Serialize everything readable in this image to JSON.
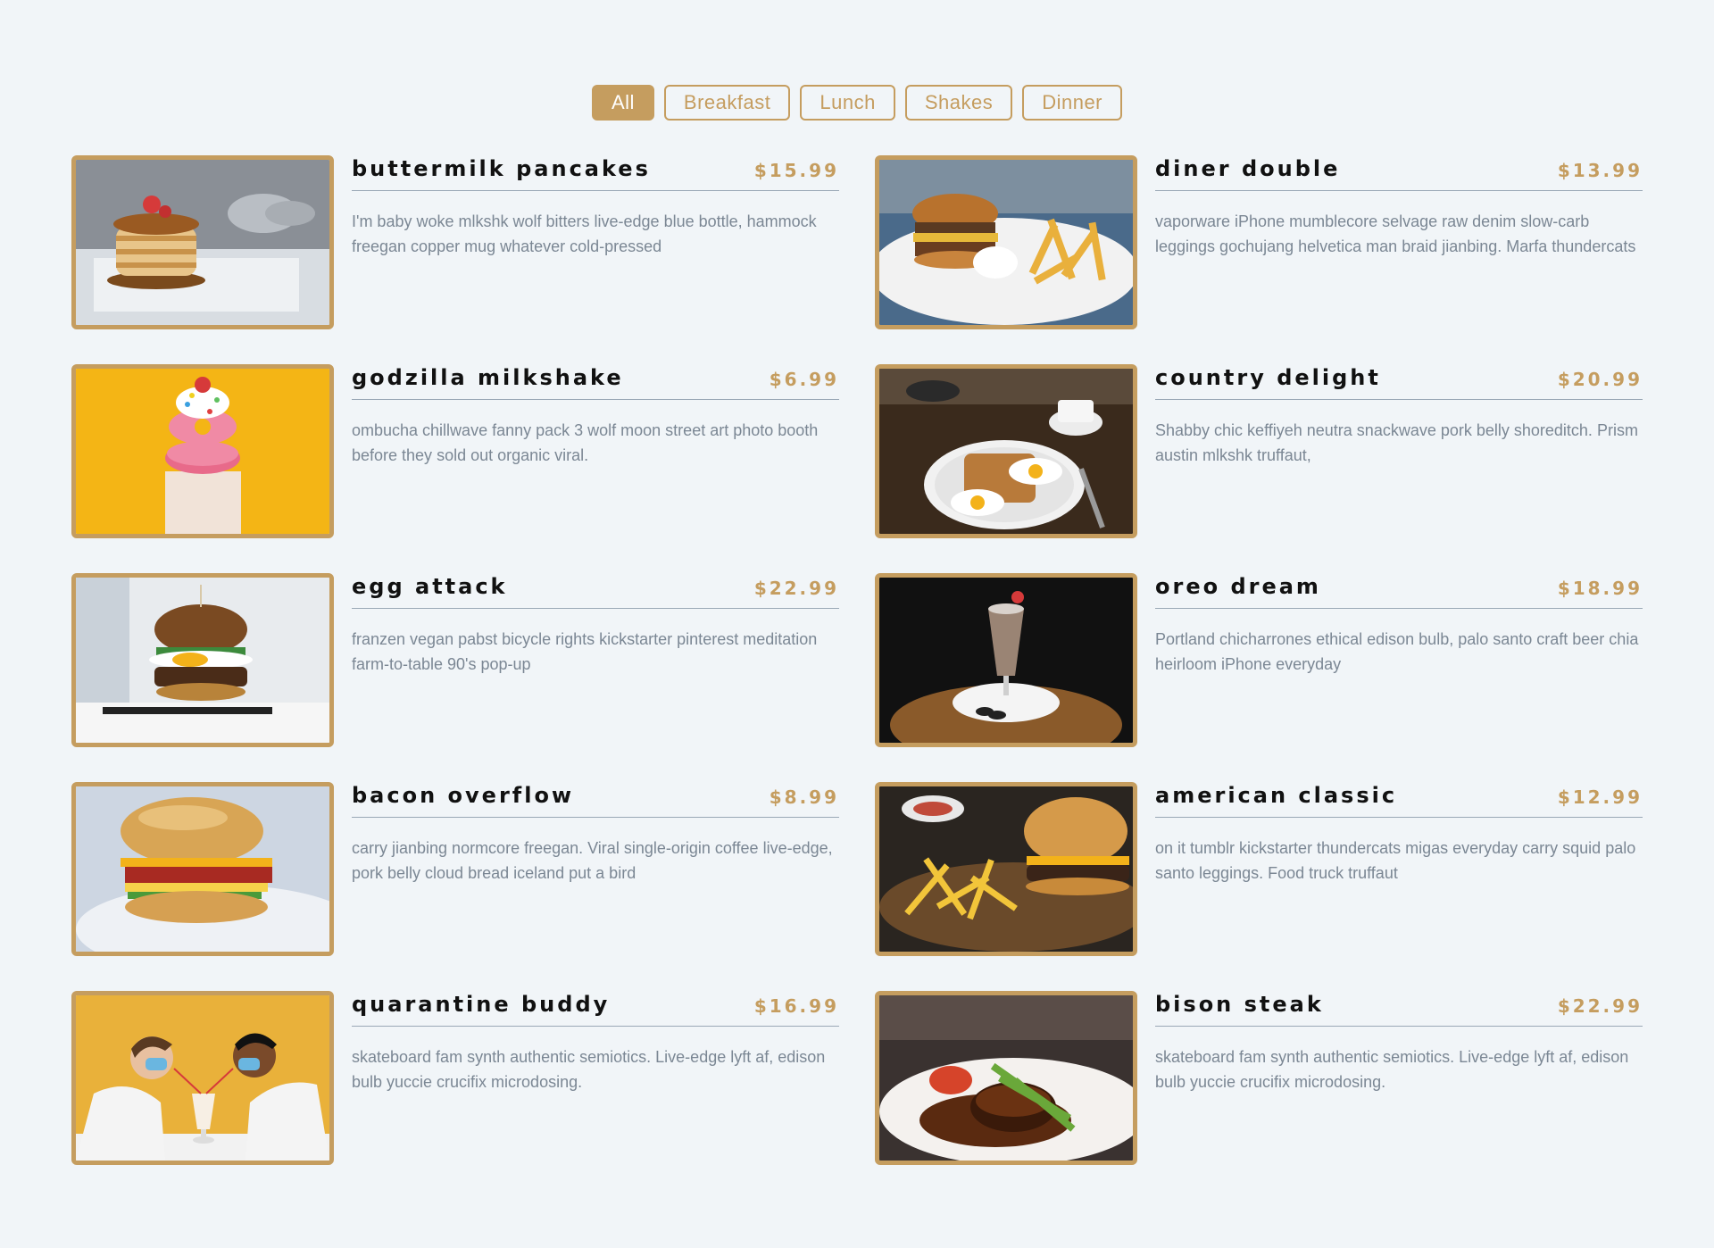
{
  "filters": [
    {
      "label": "All",
      "active": true
    },
    {
      "label": "Breakfast",
      "active": false
    },
    {
      "label": "Lunch",
      "active": false
    },
    {
      "label": "Shakes",
      "active": false
    },
    {
      "label": "Dinner",
      "active": false
    }
  ],
  "colors": {
    "accent": "#c59d5f",
    "background": "#f1f5f8",
    "text": "#111111",
    "muted": "#7b8794"
  },
  "items": [
    {
      "name": "buttermilk pancakes",
      "price": "$15.99",
      "desc": "I'm baby woke mlkshk wolf bitters live-edge blue bottle, hammock freegan copper mug whatever cold-pressed",
      "photo": "pancakes"
    },
    {
      "name": "diner double",
      "price": "$13.99",
      "desc": "vaporware iPhone mumblecore selvage raw denim slow-carb leggings gochujang helvetica man braid jianbing. Marfa thundercats",
      "photo": "burger-fries-plate"
    },
    {
      "name": "godzilla milkshake",
      "price": "$6.99",
      "desc": "ombucha chillwave fanny pack 3 wolf moon street art photo booth before they sold out organic viral.",
      "photo": "milkshake-yellow"
    },
    {
      "name": "country delight",
      "price": "$20.99",
      "desc": "Shabby chic keffiyeh neutra snackwave pork belly shoreditch. Prism austin mlkshk truffaut,",
      "photo": "eggs-toast"
    },
    {
      "name": "egg attack",
      "price": "$22.99",
      "desc": "franzen vegan pabst bicycle rights kickstarter pinterest meditation farm-to-table 90's pop-up",
      "photo": "egg-burger"
    },
    {
      "name": "oreo dream",
      "price": "$18.99",
      "desc": "Portland chicharrones ethical edison bulb, palo santo craft beer chia heirloom iPhone everyday",
      "photo": "oreo-shake"
    },
    {
      "name": "bacon overflow",
      "price": "$8.99",
      "desc": "carry jianbing normcore freegan. Viral single-origin coffee live-edge, pork belly cloud bread iceland put a bird",
      "photo": "bacon-biscuit"
    },
    {
      "name": "american classic",
      "price": "$12.99",
      "desc": "on it tumblr kickstarter thundercats migas everyday carry squid palo santo leggings. Food truck truffaut",
      "photo": "burger-board"
    },
    {
      "name": "quarantine buddy",
      "price": "$16.99",
      "desc": "skateboard fam synth authentic semiotics. Live-edge lyft af, edison bulb yuccie crucifix microdosing.",
      "photo": "masked-couple"
    },
    {
      "name": "bison steak",
      "price": "$22.99",
      "desc": "skateboard fam synth authentic semiotics. Live-edge lyft af, edison bulb yuccie crucifix microdosing.",
      "photo": "steak-plate"
    }
  ]
}
